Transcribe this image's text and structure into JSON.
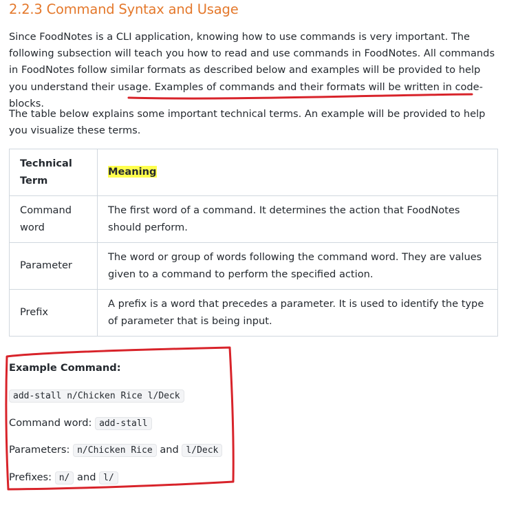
{
  "heading": "2.2.3 Command Syntax and Usage",
  "intro": "Since FoodNotes is a CLI application, knowing how to use commands is very important. The following subsection will teach you how to read and use commands in FoodNotes. All commands in FoodNotes follow similar formats as described below and examples will be provided to help you understand their usage. Examples of commands and their formats will be written in code-blocks.",
  "table_intro": "The table below explains some important technical terms. An example will be provided to help you visualize these terms.",
  "table": {
    "headers": [
      "Technical Term",
      "Meaning"
    ],
    "rows": [
      {
        "term": "Command word",
        "meaning": "The first word of a command. It determines the action that FoodNotes should perform."
      },
      {
        "term": "Parameter",
        "meaning": "The word or group of words following the command word. They are values given to a command to perform the specified action."
      },
      {
        "term": "Prefix",
        "meaning": "A prefix is a word that precedes a parameter. It is used to identify the type of parameter that is being input."
      }
    ]
  },
  "example": {
    "title": "Example Command:",
    "command": "add-stall n/Chicken Rice l/Deck",
    "command_word_label": "Command word:",
    "command_word": "add-stall",
    "parameters_label": "Parameters:",
    "param1": "n/Chicken Rice",
    "and": "and",
    "param2": "l/Deck",
    "prefixes_label": "Prefixes:",
    "prefix1": "n/",
    "prefix2": "l/"
  },
  "colors": {
    "heading": "#e4782b",
    "highlight": "#ffff4d",
    "annotation": "#d8232a"
  }
}
